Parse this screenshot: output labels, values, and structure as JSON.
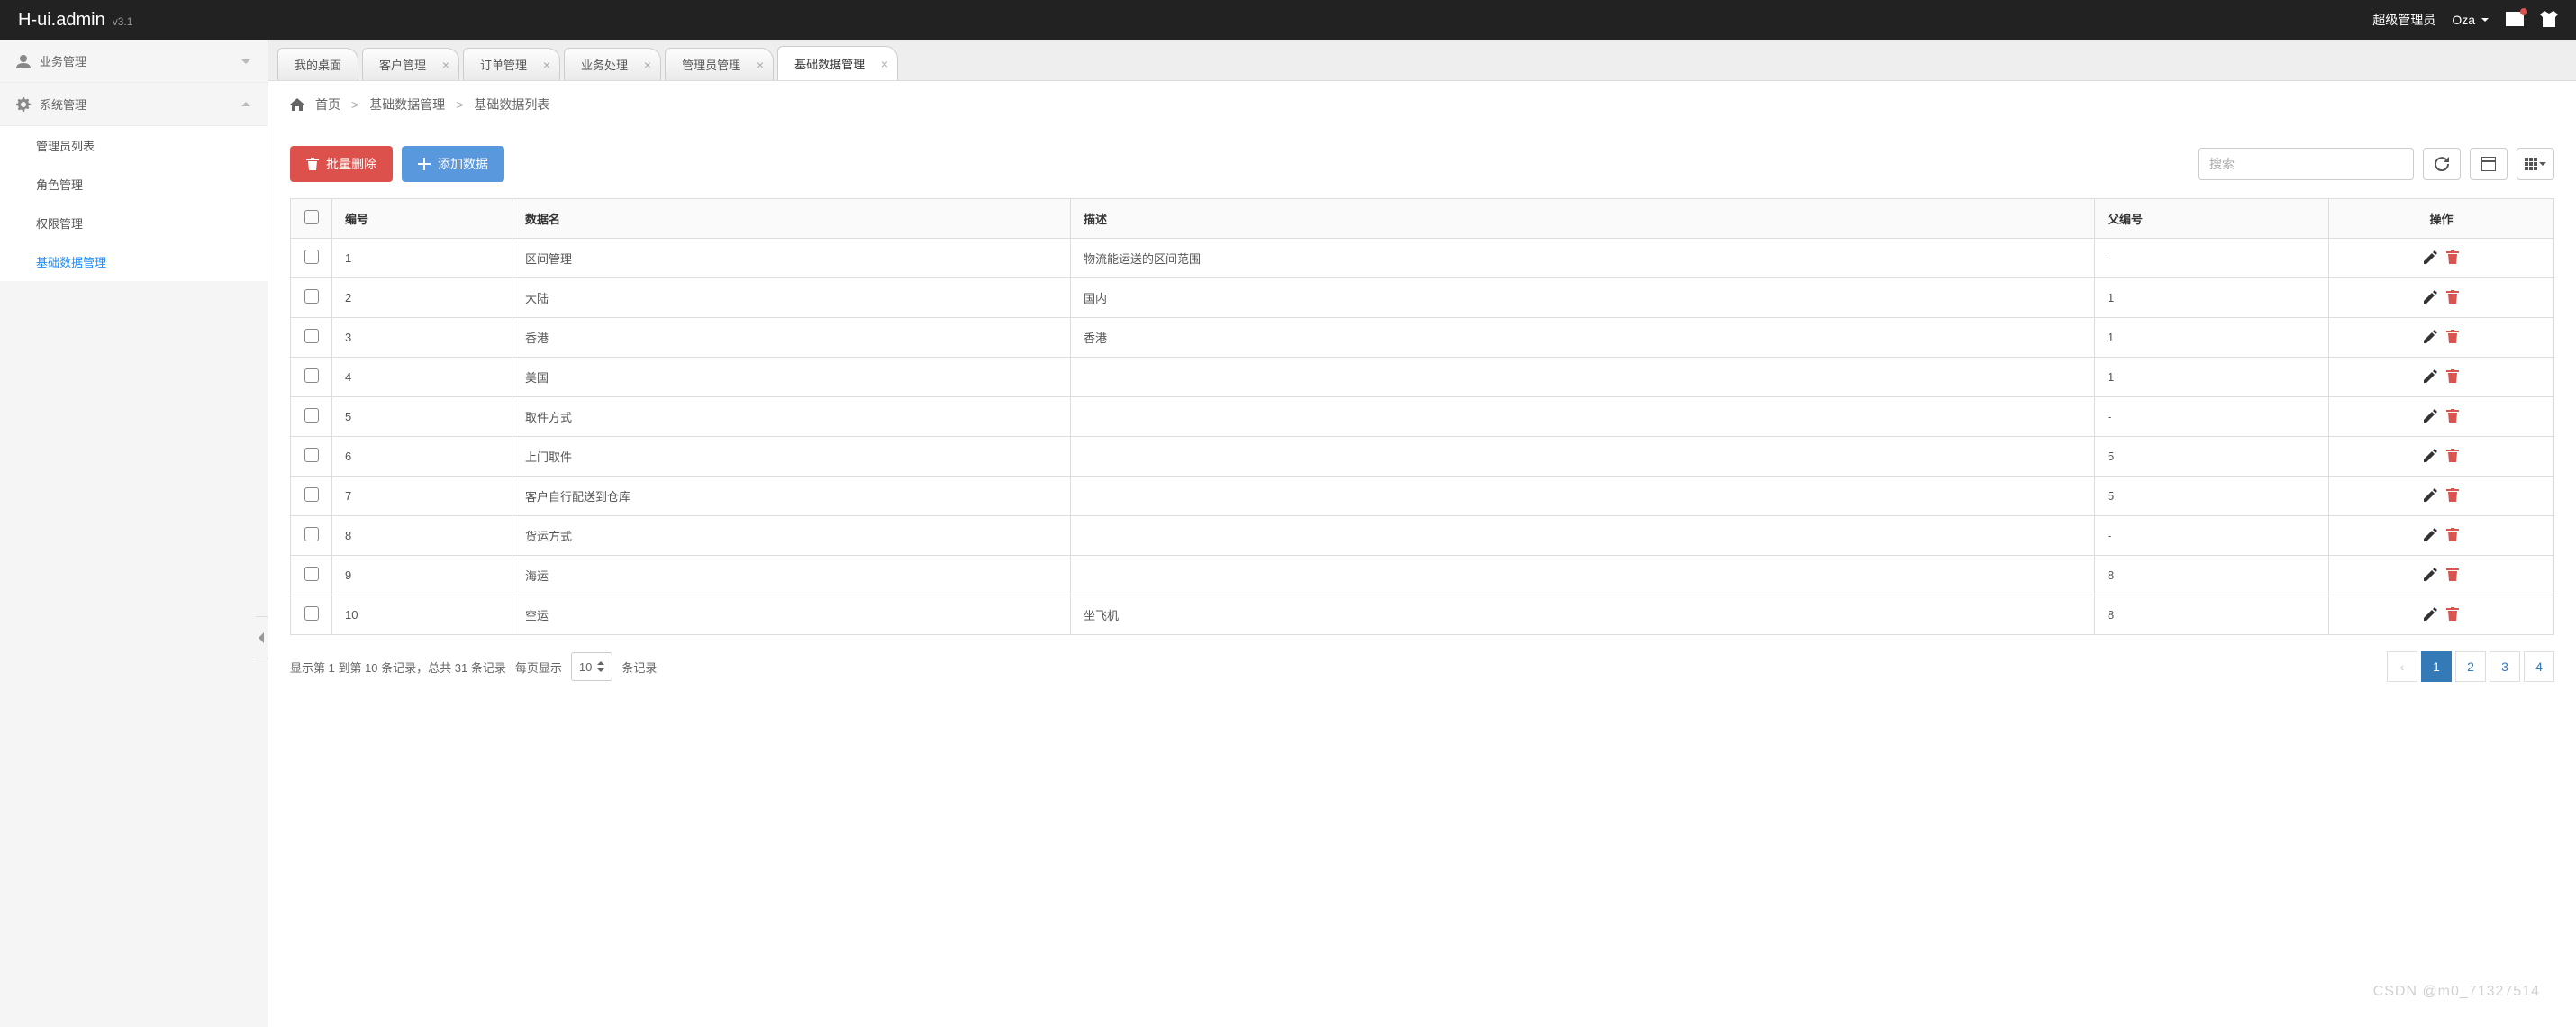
{
  "brand": {
    "name": "H-ui.admin",
    "version": "v3.1"
  },
  "top_right": {
    "role": "超级管理员",
    "user": "Oza"
  },
  "sidebar": {
    "groups": [
      {
        "icon": "user",
        "label": "业务管理",
        "open": false,
        "items": []
      },
      {
        "icon": "gear",
        "label": "系统管理",
        "open": true,
        "items": [
          {
            "label": "管理员列表",
            "active": false
          },
          {
            "label": "角色管理",
            "active": false
          },
          {
            "label": "权限管理",
            "active": false
          },
          {
            "label": "基础数据管理",
            "active": true
          }
        ]
      }
    ]
  },
  "tabs": [
    {
      "label": "我的桌面",
      "closable": false,
      "active": false
    },
    {
      "label": "客户管理",
      "closable": true,
      "active": false
    },
    {
      "label": "订单管理",
      "closable": true,
      "active": false
    },
    {
      "label": "业务处理",
      "closable": true,
      "active": false
    },
    {
      "label": "管理员管理",
      "closable": true,
      "active": false
    },
    {
      "label": "基础数据管理",
      "closable": true,
      "active": true
    }
  ],
  "breadcrumb": {
    "home": "首页",
    "mid": "基础数据管理",
    "leaf": "基础数据列表",
    "sep": ">"
  },
  "toolbar": {
    "batch_delete": "批量删除",
    "add_data": "添加数据",
    "search_placeholder": "搜索"
  },
  "table": {
    "headers": {
      "id": "编号",
      "name": "数据名",
      "desc": "描述",
      "parent": "父编号",
      "action": "操作"
    },
    "rows": [
      {
        "id": "1",
        "name": "区间管理",
        "desc": "物流能运送的区间范围",
        "parent": "-"
      },
      {
        "id": "2",
        "name": "大陆",
        "desc": "国内",
        "parent": "1"
      },
      {
        "id": "3",
        "name": "香港",
        "desc": "香港",
        "parent": "1"
      },
      {
        "id": "4",
        "name": "美国",
        "desc": "",
        "parent": "1"
      },
      {
        "id": "5",
        "name": "取件方式",
        "desc": "",
        "parent": "-"
      },
      {
        "id": "6",
        "name": "上门取件",
        "desc": "",
        "parent": "5"
      },
      {
        "id": "7",
        "name": "客户自行配送到仓库",
        "desc": "",
        "parent": "5"
      },
      {
        "id": "8",
        "name": "货运方式",
        "desc": "",
        "parent": "-"
      },
      {
        "id": "9",
        "name": "海运",
        "desc": "",
        "parent": "8"
      },
      {
        "id": "10",
        "name": "空运",
        "desc": "坐飞机",
        "parent": "8"
      }
    ]
  },
  "footer": {
    "summary_prefix": "显示第 1 到第 10 条记录，总共 31 条记录",
    "per_page_label_before": "每页显示",
    "per_page_value": "10",
    "per_page_label_after": "条记录"
  },
  "pagination": {
    "prev": "‹",
    "pages": [
      "1",
      "2",
      "3",
      "4"
    ],
    "active_index": 0
  },
  "watermark": "CSDN @m0_71327514"
}
